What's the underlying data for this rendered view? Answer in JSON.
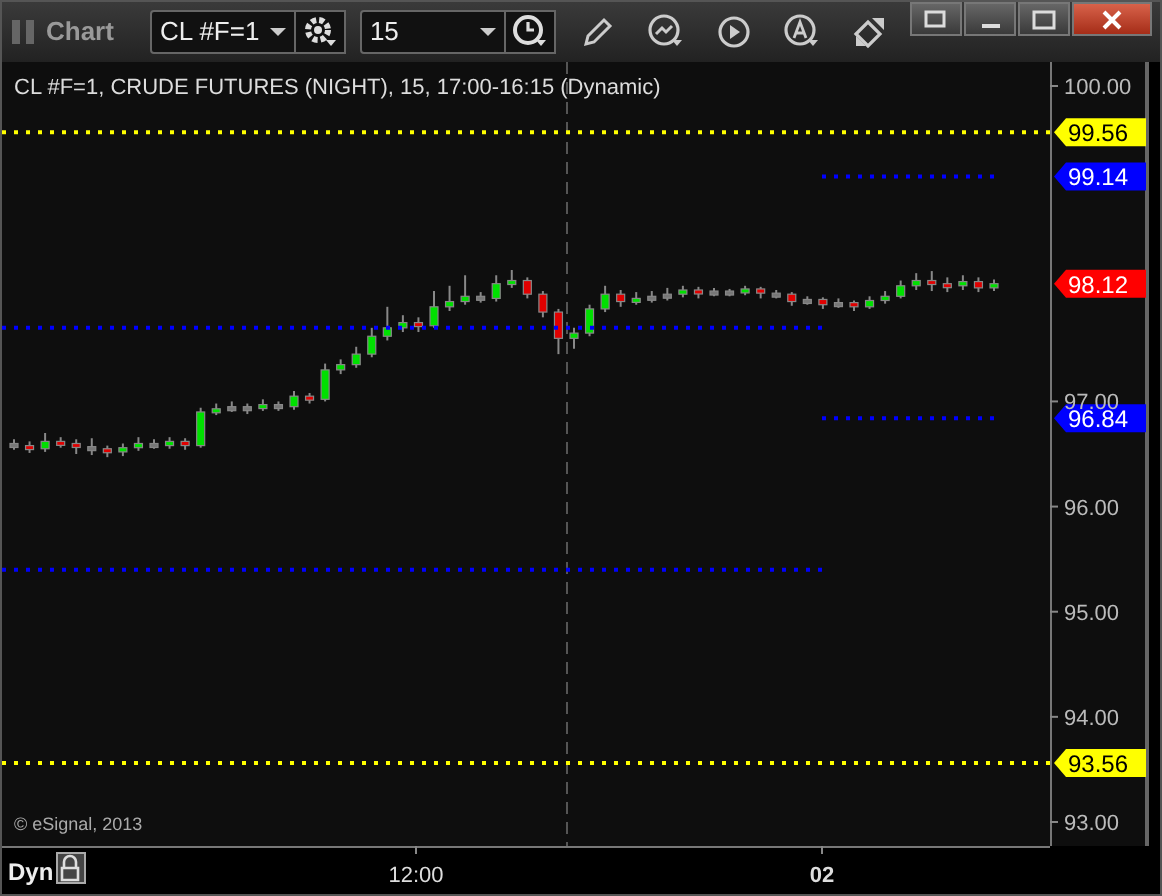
{
  "window": {
    "title": "Chart"
  },
  "toolbar": {
    "symbol": "CL #F=1",
    "interval": "15"
  },
  "chart": {
    "legend": "CL #F=1, CRUDE FUTURES (NIGHT), 15, 17:00-16:15 (Dynamic)",
    "copyright": "© eSignal, 2013",
    "chart_data": {
      "type": "candlestick",
      "ylim": [
        92.8,
        100.2
      ],
      "yticks": [
        {
          "value": 100,
          "label": "100.00"
        },
        {
          "value": 97,
          "label": "97.00"
        },
        {
          "value": 96,
          "label": "96.00"
        },
        {
          "value": 95,
          "label": "95.00"
        },
        {
          "value": 94,
          "label": "94.00"
        },
        {
          "value": 93,
          "label": "93.00"
        }
      ],
      "ohlc": [
        [
          96.6,
          96.64,
          96.54,
          96.58
        ],
        [
          96.58,
          96.62,
          96.51,
          96.55
        ],
        [
          96.55,
          96.7,
          96.52,
          96.62
        ],
        [
          96.62,
          96.66,
          96.56,
          96.6
        ],
        [
          96.6,
          96.64,
          96.5,
          96.57
        ],
        [
          96.57,
          96.65,
          96.49,
          96.55
        ],
        [
          96.55,
          96.58,
          96.47,
          96.52
        ],
        [
          96.52,
          96.6,
          96.48,
          96.56
        ],
        [
          96.56,
          96.66,
          96.53,
          96.6
        ],
        [
          96.6,
          96.64,
          96.55,
          96.58
        ],
        [
          96.58,
          96.66,
          96.55,
          96.62
        ],
        [
          96.62,
          96.65,
          96.54,
          96.58
        ],
        [
          96.58,
          96.94,
          96.56,
          96.9
        ],
        [
          96.9,
          96.98,
          96.87,
          96.93
        ],
        [
          96.93,
          97.0,
          96.9,
          96.95
        ],
        [
          96.95,
          96.98,
          96.88,
          96.94
        ],
        [
          96.94,
          97.02,
          96.91,
          96.97
        ],
        [
          96.97,
          97.0,
          96.91,
          96.95
        ],
        [
          96.95,
          97.1,
          96.92,
          97.05
        ],
        [
          97.05,
          97.08,
          96.98,
          97.02
        ],
        [
          97.02,
          97.36,
          97.0,
          97.3
        ],
        [
          97.3,
          97.4,
          97.26,
          97.35
        ],
        [
          97.35,
          97.52,
          97.32,
          97.45
        ],
        [
          97.45,
          97.7,
          97.42,
          97.62
        ],
        [
          97.62,
          97.9,
          97.58,
          97.7
        ],
        [
          97.7,
          97.82,
          97.66,
          97.75
        ],
        [
          97.75,
          97.8,
          97.66,
          97.72
        ],
        [
          97.72,
          98.05,
          97.7,
          97.9
        ],
        [
          97.9,
          98.1,
          97.86,
          97.95
        ],
        [
          97.95,
          98.2,
          97.92,
          98.0
        ],
        [
          98.0,
          98.04,
          97.94,
          97.98
        ],
        [
          97.98,
          98.2,
          97.95,
          98.12
        ],
        [
          98.12,
          98.25,
          98.08,
          98.15
        ],
        [
          98.15,
          98.18,
          97.98,
          98.02
        ],
        [
          98.02,
          98.05,
          97.8,
          97.85
        ],
        [
          97.85,
          97.88,
          97.45,
          97.6
        ],
        [
          97.6,
          97.7,
          97.5,
          97.65
        ],
        [
          97.65,
          97.92,
          97.62,
          97.88
        ],
        [
          97.88,
          98.1,
          97.85,
          98.02
        ],
        [
          98.02,
          98.06,
          97.9,
          97.95
        ],
        [
          97.95,
          98.04,
          97.92,
          97.98
        ],
        [
          97.98,
          98.05,
          97.94,
          98.0
        ],
        [
          98.0,
          98.08,
          97.96,
          98.02
        ],
        [
          98.02,
          98.1,
          97.99,
          98.06
        ],
        [
          98.06,
          98.09,
          97.98,
          98.03
        ],
        [
          98.03,
          98.08,
          98.0,
          98.05
        ],
        [
          98.05,
          98.07,
          98.0,
          98.04
        ],
        [
          98.04,
          98.1,
          98.01,
          98.07
        ],
        [
          98.07,
          98.09,
          97.98,
          98.03
        ],
        [
          98.03,
          98.06,
          97.98,
          98.02
        ],
        [
          98.02,
          98.04,
          97.91,
          97.95
        ],
        [
          97.95,
          98.0,
          97.92,
          97.97
        ],
        [
          97.97,
          97.99,
          97.88,
          97.92
        ],
        [
          97.92,
          97.98,
          97.89,
          97.94
        ],
        [
          97.94,
          97.96,
          97.86,
          97.9
        ],
        [
          97.9,
          98.0,
          97.88,
          97.96
        ],
        [
          97.96,
          98.05,
          97.93,
          98.0
        ],
        [
          98.0,
          98.15,
          97.98,
          98.1
        ],
        [
          98.1,
          98.22,
          98.06,
          98.15
        ],
        [
          98.15,
          98.24,
          98.05,
          98.12
        ],
        [
          98.12,
          98.18,
          98.04,
          98.1
        ],
        [
          98.1,
          98.2,
          98.06,
          98.14
        ],
        [
          98.14,
          98.18,
          98.04,
          98.08
        ],
        [
          98.08,
          98.16,
          98.05,
          98.12
        ]
      ]
    }
  },
  "price_tags": [
    {
      "label": "99.56",
      "color": "#ffff00"
    },
    {
      "label": "99.14",
      "color": "#0000ff"
    },
    {
      "label": "98.12",
      "color": "#ff0000"
    },
    {
      "label": "96.84",
      "color": "#0000ff"
    },
    {
      "label": "93.56",
      "color": "#ffff00"
    }
  ],
  "time_axis": {
    "labels": [
      {
        "text": "12:00",
        "bold": false
      },
      {
        "text": "02",
        "bold": true
      }
    ]
  },
  "status": {
    "mode": "Dyn"
  }
}
